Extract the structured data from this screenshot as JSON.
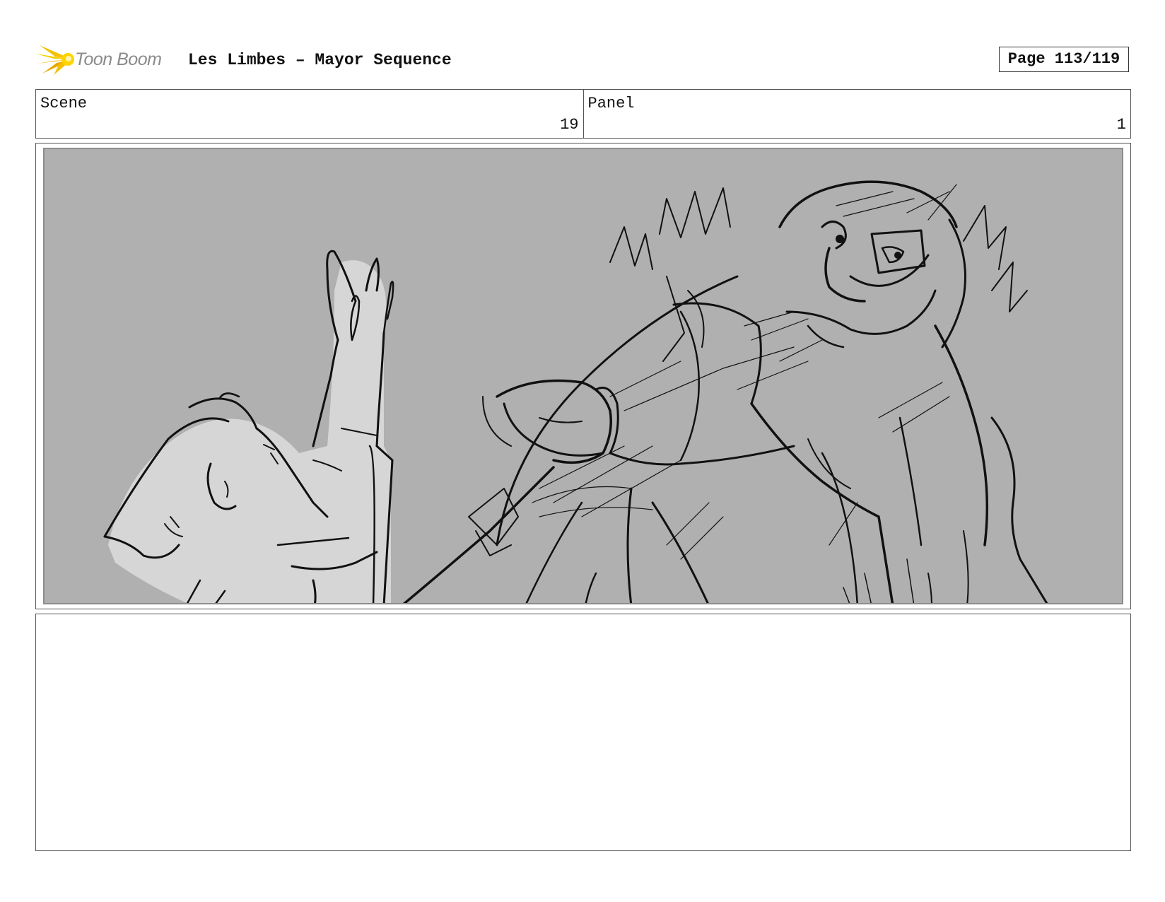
{
  "header": {
    "logo_text": "Toon Boom",
    "title": "Les Limbes – Mayor Sequence",
    "page_label": "Page 113/119"
  },
  "info": {
    "scene_label": "Scene",
    "scene_value": "19",
    "panel_label": "Panel",
    "panel_value": "1"
  },
  "panel": {
    "background_color": "#b0b0b0",
    "line_color": "#111111",
    "fill_color": "#d6d6d6"
  },
  "notes": {
    "text": ""
  }
}
